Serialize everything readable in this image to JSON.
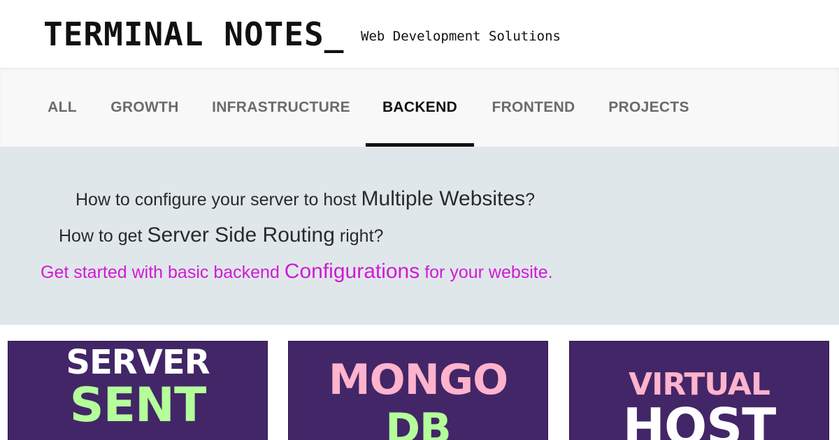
{
  "header": {
    "title": "TERMINAL NOTES_",
    "tagline": "Web Development Solutions"
  },
  "nav": {
    "tabs": [
      {
        "label": "ALL",
        "active": false
      },
      {
        "label": "GROWTH",
        "active": false
      },
      {
        "label": "INFRASTRUCTURE",
        "active": false
      },
      {
        "label": "BACKEND",
        "active": true
      },
      {
        "label": "FRONTEND",
        "active": false
      },
      {
        "label": "PROJECTS",
        "active": false
      }
    ]
  },
  "hero": {
    "line1": {
      "pre": "How to configure your server to host ",
      "highlight": "Multiple Websites",
      "post": "?"
    },
    "line2": {
      "pre": "How to get ",
      "highlight": "Server Side Routing",
      "post": " right?"
    },
    "line3": {
      "pre": "Get started with basic backend ",
      "highlight": "Configurations",
      "post": " for your website."
    },
    "accent_color": "#d11ad6"
  },
  "cards": [
    {
      "word1": "SERVER",
      "word2": "SENT",
      "color1": "#ffffff",
      "color2": "#b4ff9a"
    },
    {
      "word1": "MONGO",
      "word2": "DB",
      "color1": "#ffb3cc",
      "color2": "#b4ff9a"
    },
    {
      "word1": "VIRTUAL",
      "word2": "HOST",
      "color1": "#ffb3cc",
      "color2": "#ffffff"
    }
  ],
  "colors": {
    "card_bg": "#432667",
    "hero_bg": "#e0e7ea",
    "nav_bg": "#f8f8f8"
  }
}
